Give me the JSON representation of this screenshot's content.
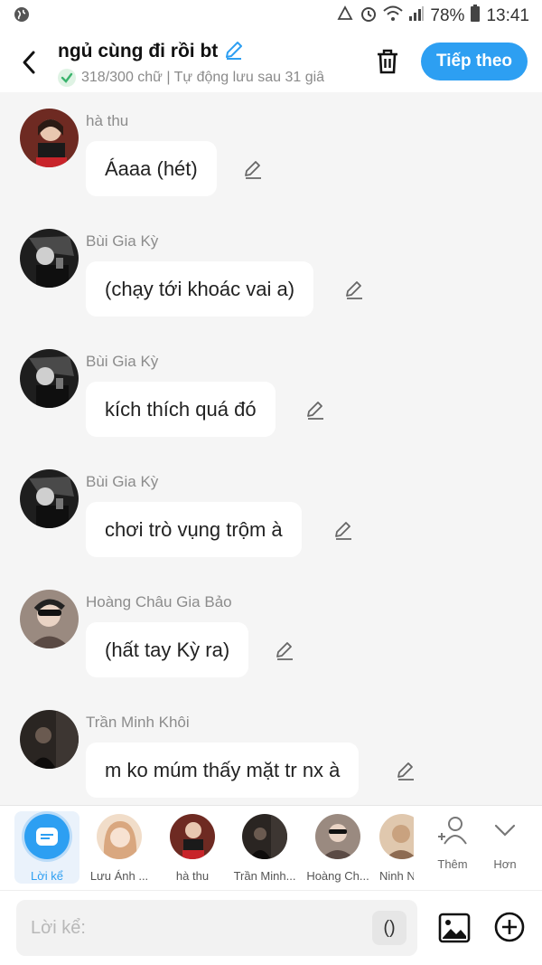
{
  "status_bar": {
    "battery": "78%",
    "time": "13:41"
  },
  "header": {
    "title": "ngủ cùng đi rồi bt",
    "subtitle": "318/300 chữ | Tự động lưu sau 31 giâ",
    "next_label": "Tiếp theo"
  },
  "messages": [
    {
      "sender": "hà thu",
      "text": "Áaaa (hét)",
      "avatar_color": "#b23a2e"
    },
    {
      "sender": "Bùi Gia Kỳ",
      "text": "(chạy tới khoác vai a)",
      "avatar_color": "#1f1f1f"
    },
    {
      "sender": "Bùi Gia Kỳ",
      "text": "kích thích quá đó",
      "avatar_color": "#1f1f1f"
    },
    {
      "sender": "Bùi Gia Kỳ",
      "text": "chơi trò vụng trộm à",
      "avatar_color": "#1f1f1f"
    },
    {
      "sender": "Hoàng Châu Gia Bảo",
      "text": "(hất tay Kỳ ra)",
      "avatar_color": "#8a7a70"
    },
    {
      "sender": "Trần Minh Khôi",
      "text": "m ko múm thấy mặt tr nx à",
      "avatar_color": "#2a2522"
    }
  ],
  "characters": [
    {
      "name": "Lời kể",
      "selected": true
    },
    {
      "name": "Lưu Ánh ...",
      "avatar_color": "#e6c4a8"
    },
    {
      "name": "hà thu",
      "avatar_color": "#b23a2e"
    },
    {
      "name": "Trần Minh...",
      "avatar_color": "#2a2522"
    },
    {
      "name": "Hoàng Ch...",
      "avatar_color": "#8a7a70"
    },
    {
      "name": "Ninh N",
      "avatar_color": "#c9a27f"
    }
  ],
  "strip_actions": {
    "add_label": "Thêm",
    "more_label": "Hơn"
  },
  "composer": {
    "placeholder": "Lời kể:",
    "paren_label": "()"
  },
  "colors": {
    "accent": "#2d9ff2",
    "background": "#f5f5f5",
    "bubble": "#ffffff"
  }
}
